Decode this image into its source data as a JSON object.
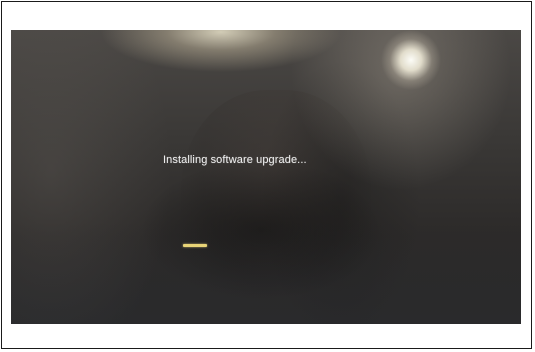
{
  "screen": {
    "status_text": "Installing software upgrade...",
    "progress_color": "#e8d477"
  }
}
